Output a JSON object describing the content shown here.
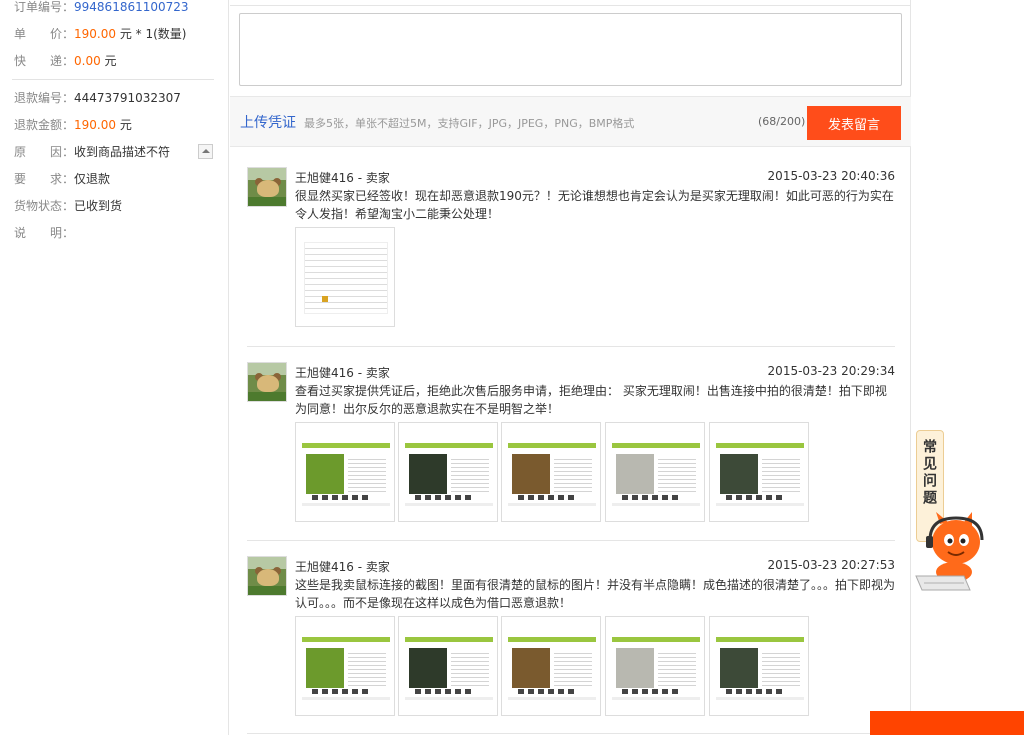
{
  "order": {
    "order_no_label": "订单编号：",
    "order_no": "994861861100723",
    "price_label": "单　　价：",
    "price": "190.00",
    "price_suffix": " 元 * 1(数量)",
    "shipping_label": "快　　递：",
    "shipping": "0.00",
    "shipping_suffix": " 元",
    "refund_no_label": "退款编号：",
    "refund_no": "44473791032307",
    "refund_amount_label": "退款金额：",
    "refund_amount": "190.00",
    "refund_amount_suffix": " 元",
    "reason_label": "原　　因：",
    "reason": "收到商品描述不符",
    "request_label": "要　　求：",
    "request": "仅退款",
    "goods_status_label": "货物状态：",
    "goods_status": "已收到货",
    "note_label": "说　　明："
  },
  "composer": {
    "upload_label": "上传凭证",
    "upload_hint": "最多5张，单张不超过5M，支持GIF，JPG，JPEG，PNG，BMP格式",
    "char_count": "(68/200)",
    "submit_label": "发表留言"
  },
  "messages": [
    {
      "author": "王旭健416 - 卖家",
      "time": "2015-03-23 20:40:36",
      "text": "很显然买家已经签收！现在却恶意退款190元？！无论谁想想也肯定会认为是买家无理取闹！如此可恶的行为实在令人发指！希望淘宝小二能秉公处理！",
      "attachments": 1
    },
    {
      "author": "王旭健416 - 卖家",
      "time": "2015-03-23 20:29:34",
      "text": "查看过买家提供凭证后，拒绝此次售后服务申请，拒绝理由： 买家无理取闹！出售连接中拍的很清楚！拍下即视为同意！出尔反尔的恶意退款实在不是明智之举！",
      "attachments": 5
    },
    {
      "author": "王旭健416 - 卖家",
      "time": "2015-03-23 20:27:53",
      "text": "这些是我卖鼠标连接的截图！里面有很清楚的鼠标的图片！并没有半点隐瞒！成色描述的很清楚了。。。拍下即视为认可。。。而不是像现在这样以成色为借口恶意退款！",
      "attachments": 5
    }
  ],
  "faq": {
    "label": "常见问题"
  },
  "colors": {
    "accent_orange": "#ff4d1a",
    "link_blue": "#3366cc",
    "price_orange": "#ff6600"
  },
  "icons": [
    "collapse-up-icon",
    "mascot-icon"
  ]
}
